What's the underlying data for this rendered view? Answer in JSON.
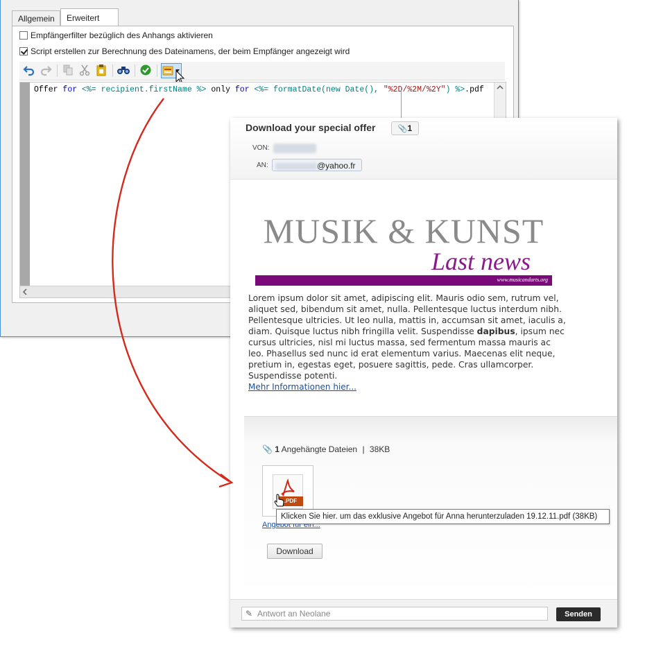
{
  "tabs": [
    {
      "label": "Allgemein"
    },
    {
      "label": "Erweitert"
    }
  ],
  "options": {
    "filter_label": "Empfängerfilter bezüglich des Anhangs aktivieren",
    "filter_checked": false,
    "script_label": "Script erstellen zur Berechnung des Dateinamens, der beim Empfänger angezeigt wird",
    "script_checked": true
  },
  "toolbar_icons": [
    "undo-icon",
    "redo-icon",
    "copy-icon",
    "cut-icon",
    "paste-icon",
    "find-icon",
    "validate-icon",
    "insert-field-icon",
    "dropdown-arrow-icon"
  ],
  "code": {
    "p1": "Offer ",
    "p2": "for ",
    "p3": "<%= recipient.firstName %>",
    "p4": " only ",
    "p5": "for ",
    "p6": "<%= formatDate(new Date(), ",
    "p7": "\"%2D/%2M/%2Y\"",
    "p8": ") %>",
    "p9": ".pdf"
  },
  "mail": {
    "subject": "Download your special offer",
    "attachment_badge": "1",
    "from_label": "VON:",
    "to_label": "AN:",
    "to_domain": "@yahoo.fr",
    "banner_title": "MUSIK & KUNST",
    "banner_subtitle": "Last news",
    "banner_url": "www.musicandarts.org",
    "body_before_bold": "Lorem ipsum dolor sit amet, adipiscing elit. Mauris odio sem, rutrum vel, aliquet sed, bibendum sit amet, nulla. Pellentesque luctus interdum nibh. Pellentesque ultricies. Ut leo nulla, mattis in, accumsan sit amet, iaculis a, diam. Quisque luctus nibh fringilla velit. Suspendisse ",
    "body_bold": "dapibus",
    "body_after_bold": ", ipsum nec cursus ultricies, nisl mi luctus massa, sed fermentum massa mauris ac leo. Phasellus sed nunc id erat elementum varius. Maecenas elit neque, pretium in, egestas eget, posuere sagittis, pede. Cras ullamcorper. Suspendisse potenti.",
    "more_link": "Mehr Informationen hier...",
    "attachments_count": "1",
    "attachments_label": "Angehängte Dateien",
    "attachments_sep": "|",
    "attachments_size": "38KB",
    "pdf_label": ".PDF",
    "attachment_name": "Angebot für ein...",
    "tooltip": "Klicken Sie hier. um das exklusive Angebot für Anna herunterzuladen 19.12.11.pdf (38KB)",
    "download_button": "Download",
    "reply_placeholder": "Antwort an Neolane",
    "send_button": "Senden"
  },
  "colors": {
    "banner_purple": "#7a0a7a",
    "arrow_red": "#d42a1c",
    "link_blue": "#1a4fa0"
  }
}
